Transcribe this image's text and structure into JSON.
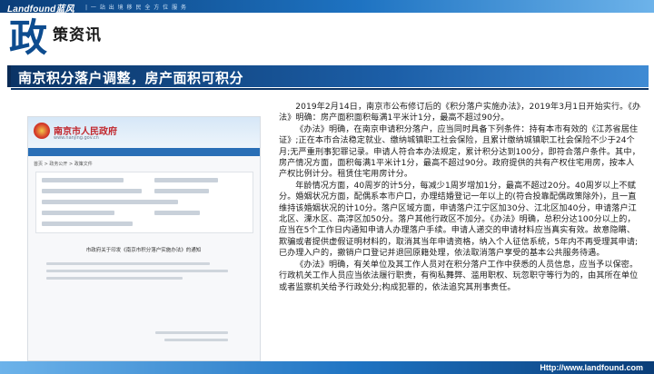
{
  "brand": {
    "logo": "Landfound蓝风",
    "slogan": "| 一 站 出 境 移 民 全 方 位 服 务",
    "website": "Http://www.landfound.com"
  },
  "header": {
    "big_char": "政",
    "subtitle": "策资讯"
  },
  "headline": "南京积分落户调整，房产面积可积分",
  "gov_screenshot": {
    "site_name": "南京市人民政府",
    "site_url": "www.nanjing.gov.cn",
    "breadcrumb": "首页 > 政务公开 > 政策文件",
    "doc_title": "市政府关于印发《南京市积分落户实施办法》的通知"
  },
  "paragraphs": [
    "2019年2月14日，南京市公布修订后的《积分落户实施办法》，2019年3月1日开始实行。《办法》明确：房产面积面积每满1平米计1分，最高不超过90分。",
    "《办法》明确，在南京申请积分落户，应当同时具备下列条件：持有本市有效的《江苏省居住证》;正在本市合法稳定就业、缴纳城镇职工社会保险，且累计缴纳城镇职工社会保险不少于24个月;无严重刑事犯罪记录。申请人符合本办法规定，累计积分达到100分，即符合落户条件。其中，房产情况方面，面积每满1平米计1分，最高不超过90分。政府提供的共有产权住宅用房，按本人产权比例计分。租赁住宅用房计分。",
    "年龄情况方面，40周岁的计5分，每减少1周岁增加1分，最高不超过20分。40周岁以上不赋分。婚姻状况方面，配偶系本市户口，办理结婚登记一年以上的(符合投靠配偶政策除外)，且一直维持该婚姻状况的计10分。落户区域方面，申请落户江宁区加30分、江北区加40分，申请落户江北区、溧水区、高淳区加50分。落户其他行政区不加分。《办法》明确，总积分达100分以上的，应当在5个工作日内通知申请人办理落户手续。申请人递交的申请材料应当真实有效。故意隐瞒、欺骗或者提供虚假证明材料的，取消其当年申请资格，纳入个人征信系统，5年内不再受理其申请;已办理入户的，撤销户口登记并退回原籍处理，依法取消落户享受的基本公共服务待遇。",
    "《办法》明确，有关单位及其工作人员对在积分落户工作中获悉的人员信息，应当予以保密。行政机关工作人员应当依法履行职责，有徇私舞弊、滥用职权、玩忽职守等行为的，由其所在单位或者监察机关给予行政处分;构成犯罪的，依法追究其刑事责任。"
  ],
  "colors": {
    "brand_dark": "#0a3d78",
    "brand_blue": "#1e73c2",
    "headline_bg": "#1c5fa8",
    "title_blue": "#0d4c8f"
  }
}
